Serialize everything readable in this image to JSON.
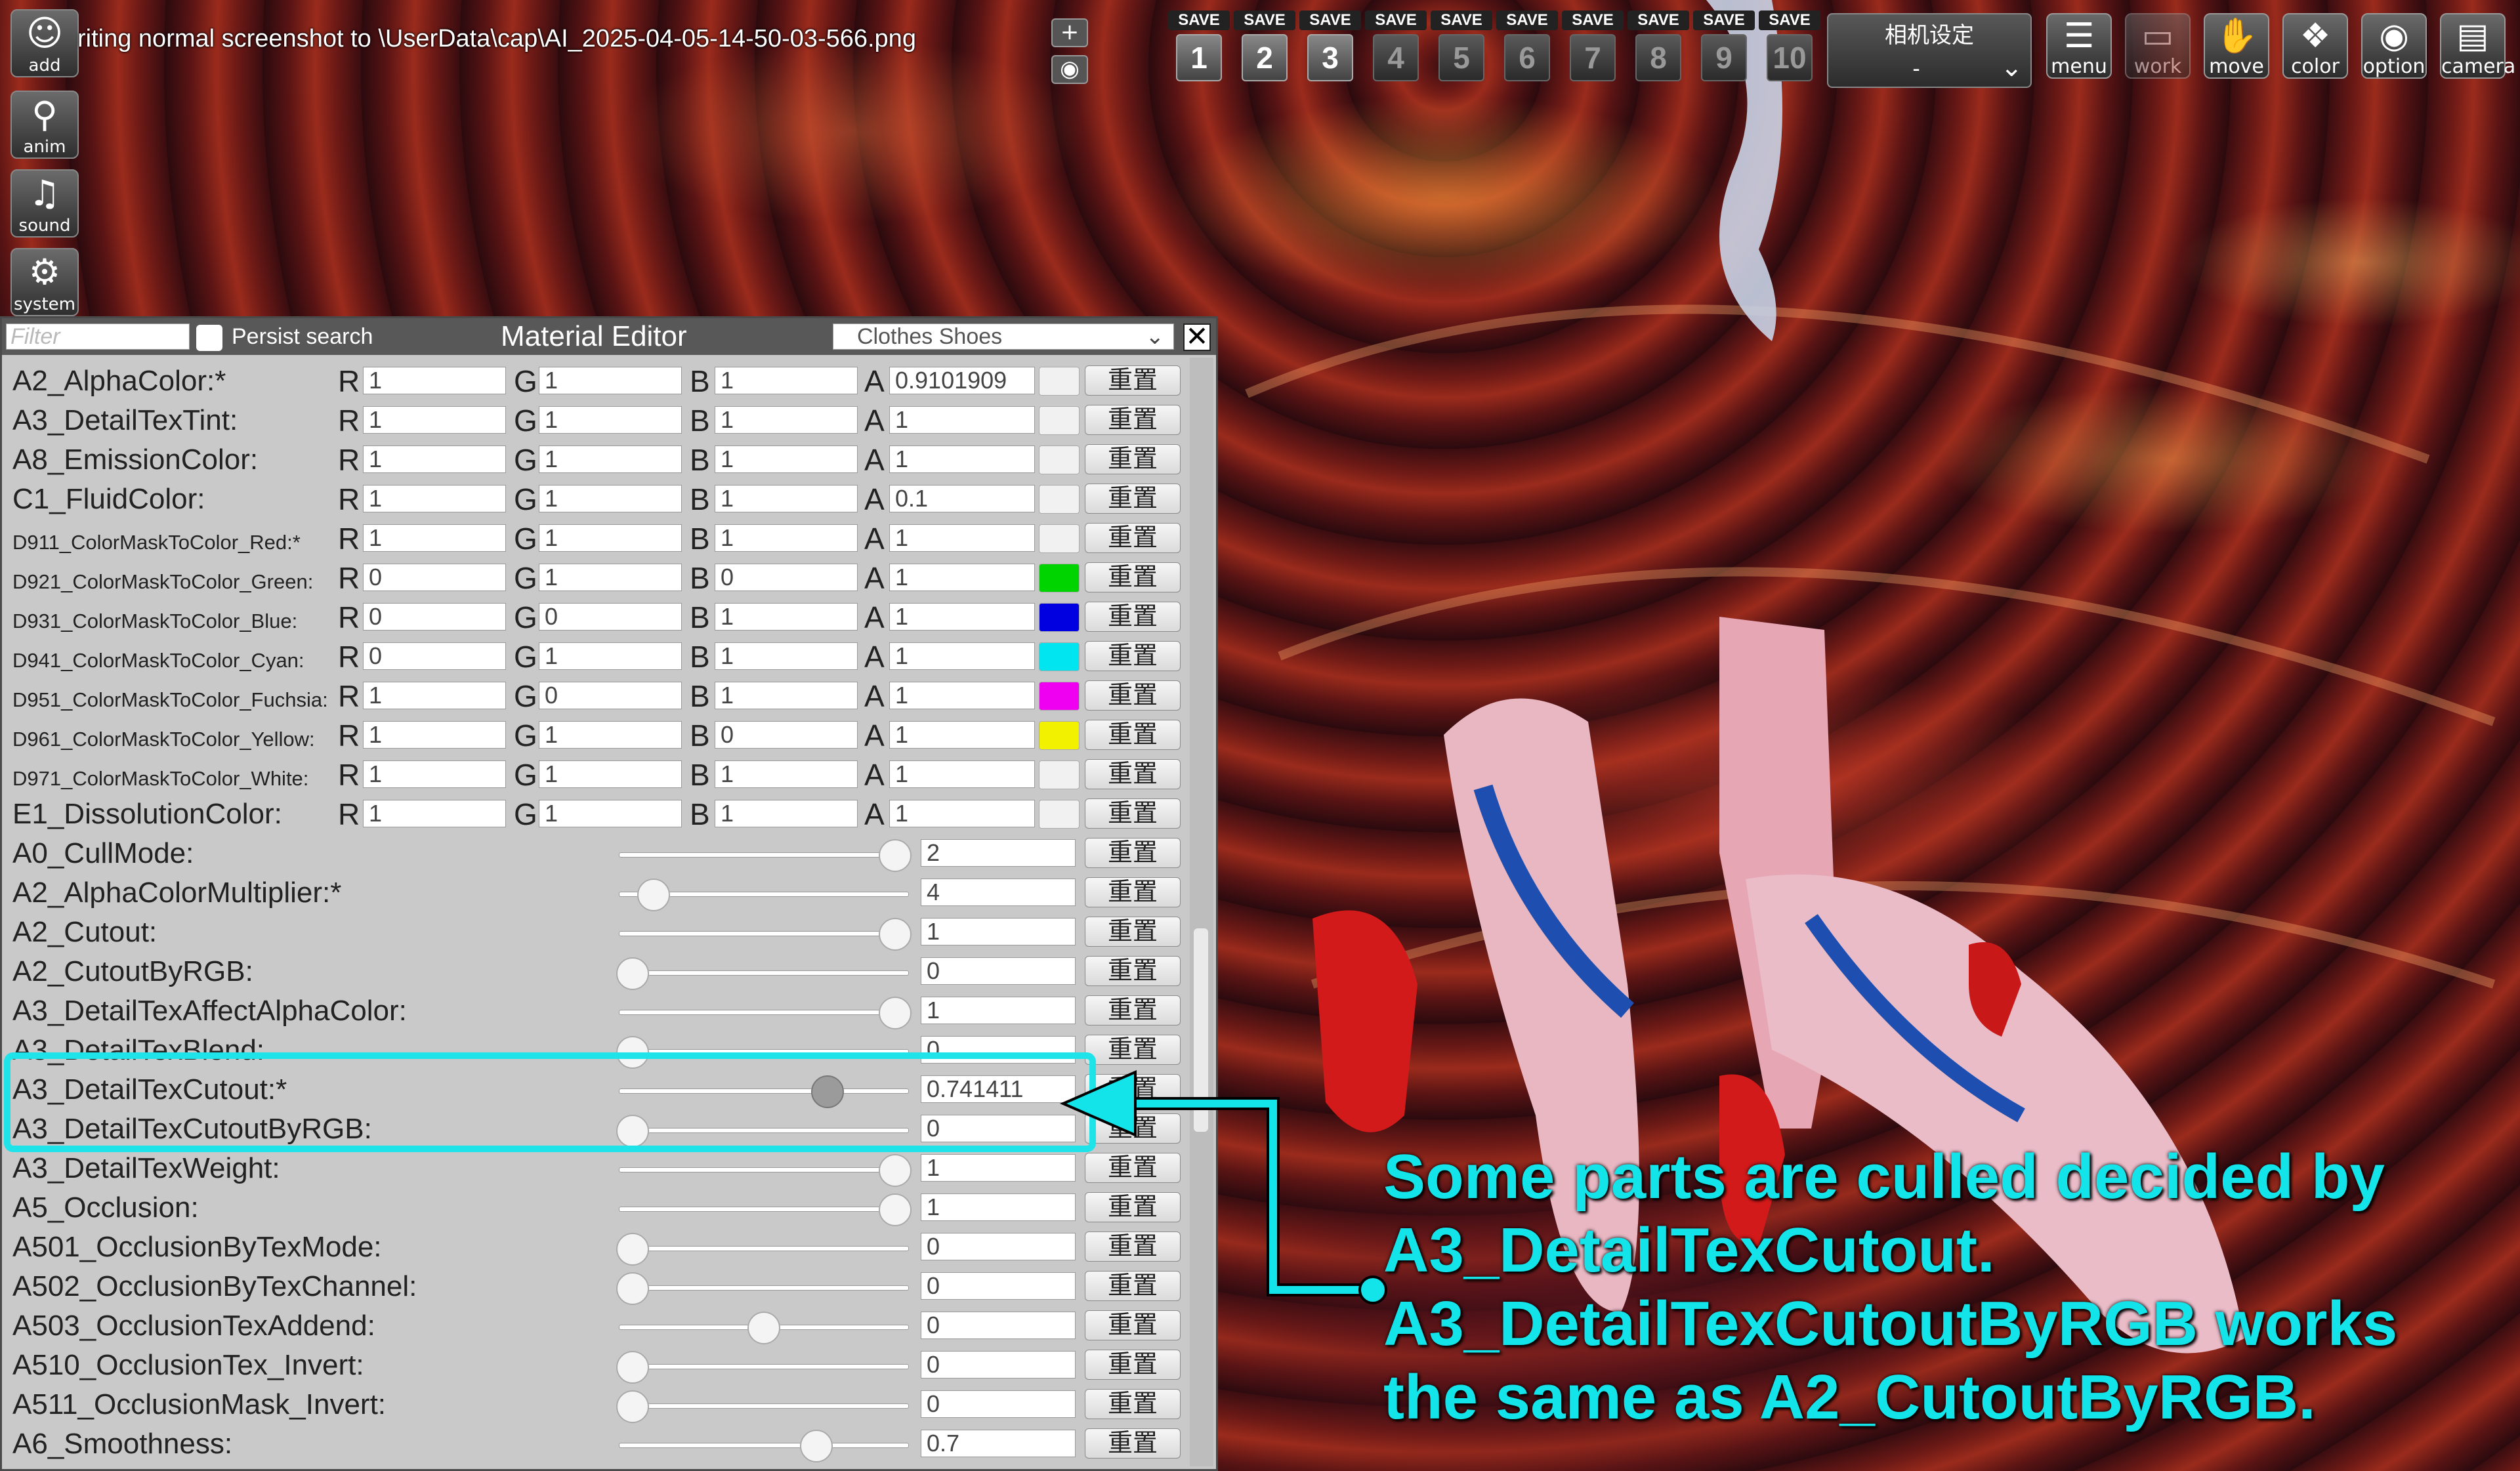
{
  "status_message": "riting normal screenshot to \\UserData\\cap\\AI_2025-04-05-14-50-03-566.png",
  "left_bar": [
    {
      "label": "add",
      "icon": "person-add-icon"
    },
    {
      "label": "anim",
      "icon": "running-figure-icon"
    },
    {
      "label": "sound",
      "icon": "music-note-icon"
    },
    {
      "label": "system",
      "icon": "gears-icon"
    }
  ],
  "small_buttons": {
    "plus": "+",
    "eye": "eye-icon"
  },
  "save_slots": [
    {
      "label": "SAVE",
      "num": "1"
    },
    {
      "label": "SAVE",
      "num": "2"
    },
    {
      "label": "SAVE",
      "num": "3"
    },
    {
      "label": "SAVE",
      "num": "4"
    },
    {
      "label": "SAVE",
      "num": "5"
    },
    {
      "label": "SAVE",
      "num": "6"
    },
    {
      "label": "SAVE",
      "num": "7"
    },
    {
      "label": "SAVE",
      "num": "8"
    },
    {
      "label": "SAVE",
      "num": "9"
    },
    {
      "label": "SAVE",
      "num": "10"
    }
  ],
  "camera_settings": {
    "title": "相机设定",
    "value": "-"
  },
  "top_icons": [
    {
      "label": "menu",
      "icon": "menu-list-icon"
    },
    {
      "label": "work",
      "icon": "work-frame-icon"
    },
    {
      "label": "move",
      "icon": "hand-icon"
    },
    {
      "label": "color",
      "icon": "palette-icon"
    },
    {
      "label": "option",
      "icon": "eye-icon"
    },
    {
      "label": "camera",
      "icon": "clapper-icon"
    }
  ],
  "editor": {
    "filter_placeholder": "Filter",
    "persist_label": "Persist search",
    "title": "Material Editor",
    "dropdown_value": "Clothes Shoes",
    "reset_label": "重置",
    "color_rows": [
      {
        "name": "A2_AlphaColor:*",
        "r": "1",
        "g": "1",
        "b": "1",
        "a": "0.9101909",
        "swatch": "#f1f1f1"
      },
      {
        "name": "A3_DetailTexTint:",
        "r": "1",
        "g": "1",
        "b": "1",
        "a": "1",
        "swatch": "#f1f1f1"
      },
      {
        "name": "A8_EmissionColor:",
        "r": "1",
        "g": "1",
        "b": "1",
        "a": "1",
        "swatch": "#f1f1f1"
      },
      {
        "name": "C1_FluidColor:",
        "r": "1",
        "g": "1",
        "b": "1",
        "a": "0.1",
        "swatch": "#f1f1f1"
      },
      {
        "name": "D911_ColorMaskToColor_Red:*",
        "r": "1",
        "g": "1",
        "b": "1",
        "a": "1",
        "swatch": "#f1f1f1"
      },
      {
        "name": "D921_ColorMaskToColor_Green:",
        "r": "0",
        "g": "1",
        "b": "0",
        "a": "1",
        "swatch": "#00d400"
      },
      {
        "name": "D931_ColorMaskToColor_Blue:",
        "r": "0",
        "g": "0",
        "b": "1",
        "a": "1",
        "swatch": "#0000e0"
      },
      {
        "name": "D941_ColorMaskToColor_Cyan:",
        "r": "0",
        "g": "1",
        "b": "1",
        "a": "1",
        "swatch": "#00e5ef"
      },
      {
        "name": "D951_ColorMaskToColor_Fuchsia:",
        "r": "1",
        "g": "0",
        "b": "1",
        "a": "1",
        "swatch": "#f000f0"
      },
      {
        "name": "D961_ColorMaskToColor_Yellow:",
        "r": "1",
        "g": "1",
        "b": "0",
        "a": "1",
        "swatch": "#f2f200"
      },
      {
        "name": "D971_ColorMaskToColor_White:",
        "r": "1",
        "g": "1",
        "b": "1",
        "a": "1",
        "swatch": "#f1f1f1"
      },
      {
        "name": "E1_DissolutionColor:",
        "r": "1",
        "g": "1",
        "b": "1",
        "a": "1",
        "swatch": "#f1f1f1"
      }
    ],
    "slider_rows": [
      {
        "name": "A0_CullMode:",
        "value": "2",
        "level": 1.0
      },
      {
        "name": "A2_AlphaColorMultiplier:*",
        "value": "4",
        "level": 0.08
      },
      {
        "name": "A2_Cutout:",
        "value": "1",
        "level": 1.0
      },
      {
        "name": "A2_CutoutByRGB:",
        "value": "0",
        "level": 0.0
      },
      {
        "name": "A3_DetailTexAffectAlphaColor:",
        "value": "1",
        "level": 1.0
      },
      {
        "name": "A3_DetailTexBlend:",
        "value": "0",
        "level": 0.0
      },
      {
        "name": "A3_DetailTexCutout:*",
        "value": "0.741411",
        "level": 0.741411
      },
      {
        "name": "A3_DetailTexCutoutByRGB:",
        "value": "0",
        "level": 0.0
      },
      {
        "name": "A3_DetailTexWeight:",
        "value": "1",
        "level": 1.0
      },
      {
        "name": "A5_Occlusion:",
        "value": "1",
        "level": 1.0
      },
      {
        "name": "A501_OcclusionByTexMode:",
        "value": "0",
        "level": 0.0
      },
      {
        "name": "A502_OcclusionByTexChannel:",
        "value": "0",
        "level": 0.0
      },
      {
        "name": "A503_OcclusionTexAddend:",
        "value": "0",
        "level": 0.5
      },
      {
        "name": "A510_OcclusionTex_Invert:",
        "value": "0",
        "level": 0.0
      },
      {
        "name": "A511_OcclusionMask_Invert:",
        "value": "0",
        "level": 0.0
      },
      {
        "name": "A6_Smoothness:",
        "value": "0.7",
        "level": 0.7
      }
    ]
  },
  "annotation": {
    "lines": [
      "Some parts are culled decided by",
      "A3_DetailTexCutout.",
      "A3_DetailTexCutoutByRGB works",
      "the same as A2_CutoutByRGB."
    ],
    "accent_color": "#12e4ea"
  }
}
